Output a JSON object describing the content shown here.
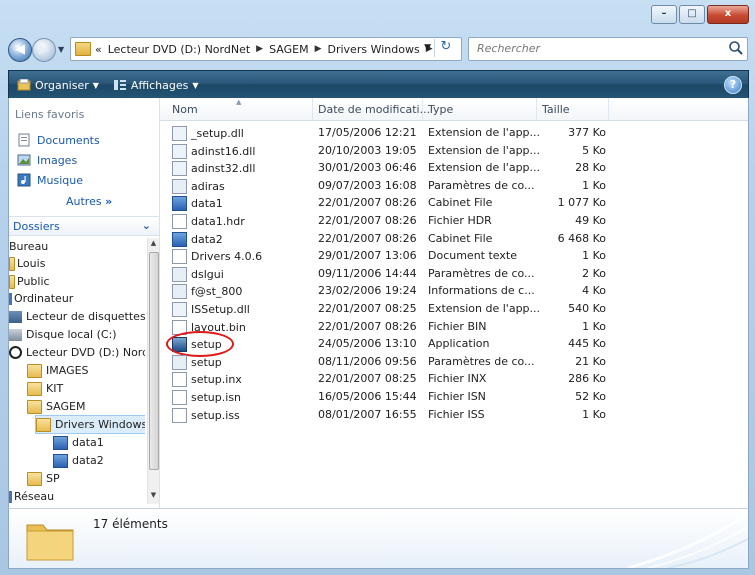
{
  "window": {
    "caption_buttons": [
      "–",
      "□",
      "x"
    ]
  },
  "address": {
    "crumbs": [
      "«",
      "Lecteur DVD (D:) NordNet",
      "SAGEM",
      "Drivers Windows"
    ],
    "search_placeholder": "Rechercher"
  },
  "toolbar": {
    "organize": "Organiser",
    "views": "Affichages",
    "help": "?"
  },
  "left_pane": {
    "favorites_header": "Liens favoris",
    "favorites": [
      "Documents",
      "Images",
      "Musique"
    ],
    "more": "Autres",
    "folders_header": "Dossiers",
    "tree": [
      "Bureau",
      "Louis",
      "Public",
      "Ordinateur",
      "Lecteur de disquettes (",
      "Disque local (C:)",
      "Lecteur DVD (D:) Nord",
      "IMAGES",
      "KIT",
      "SAGEM",
      "Drivers Windows",
      "data1",
      "data2",
      "SP",
      "Réseau"
    ]
  },
  "columns": {
    "name": "Nom",
    "date": "Date de modificati...",
    "type": "Type",
    "size": "Taille"
  },
  "files": [
    {
      "name": "_setup.dll",
      "date": "17/05/2006 12:21",
      "type": "Extension de l'app...",
      "size": "377 Ko",
      "icon": "dll"
    },
    {
      "name": "adinst16.dll",
      "date": "20/10/2003 19:05",
      "type": "Extension de l'app...",
      "size": "5 Ko",
      "icon": "dll"
    },
    {
      "name": "adinst32.dll",
      "date": "30/01/2003 06:46",
      "type": "Extension de l'app...",
      "size": "28 Ko",
      "icon": "dll"
    },
    {
      "name": "adiras",
      "date": "09/07/2003 16:08",
      "type": "Paramètres de co...",
      "size": "1 Ko",
      "icon": "cfg"
    },
    {
      "name": "data1",
      "date": "22/01/2007 08:26",
      "type": "Cabinet File",
      "size": "1 077 Ko",
      "icon": "cab"
    },
    {
      "name": "data1.hdr",
      "date": "22/01/2007 08:26",
      "type": "Fichier HDR",
      "size": "49 Ko",
      "icon": "doc"
    },
    {
      "name": "data2",
      "date": "22/01/2007 08:26",
      "type": "Cabinet File",
      "size": "6 468 Ko",
      "icon": "cab"
    },
    {
      "name": "Drivers 4.0.6",
      "date": "29/01/2007 13:06",
      "type": "Document texte",
      "size": "1 Ko",
      "icon": "doc"
    },
    {
      "name": "dslgui",
      "date": "09/11/2006 14:44",
      "type": "Paramètres de co...",
      "size": "2 Ko",
      "icon": "cfg"
    },
    {
      "name": "f@st_800",
      "date": "23/02/2006 19:24",
      "type": "Informations de c...",
      "size": "4 Ko",
      "icon": "cfg"
    },
    {
      "name": "ISSetup.dll",
      "date": "22/01/2007 08:25",
      "type": "Extension de l'app...",
      "size": "540 Ko",
      "icon": "dll"
    },
    {
      "name": "layout.bin",
      "date": "22/01/2007 08:26",
      "type": "Fichier BIN",
      "size": "1 Ko",
      "icon": "doc"
    },
    {
      "name": "setup",
      "date": "24/05/2006 13:10",
      "type": "Application",
      "size": "445 Ko",
      "icon": "app"
    },
    {
      "name": "setup",
      "date": "08/11/2006 09:56",
      "type": "Paramètres de co...",
      "size": "21 Ko",
      "icon": "cfg"
    },
    {
      "name": "setup.inx",
      "date": "22/01/2007 08:25",
      "type": "Fichier INX",
      "size": "286 Ko",
      "icon": "doc"
    },
    {
      "name": "setup.isn",
      "date": "16/05/2006 15:44",
      "type": "Fichier ISN",
      "size": "52 Ko",
      "icon": "doc"
    },
    {
      "name": "setup.iss",
      "date": "08/01/2007 16:55",
      "type": "Fichier ISS",
      "size": "1 Ko",
      "icon": "doc"
    }
  ],
  "details": {
    "count": "17 éléments"
  },
  "colors": {
    "toolbar": "#2a5677",
    "link": "#1a59a8",
    "highlight_circle": "#e01818"
  }
}
